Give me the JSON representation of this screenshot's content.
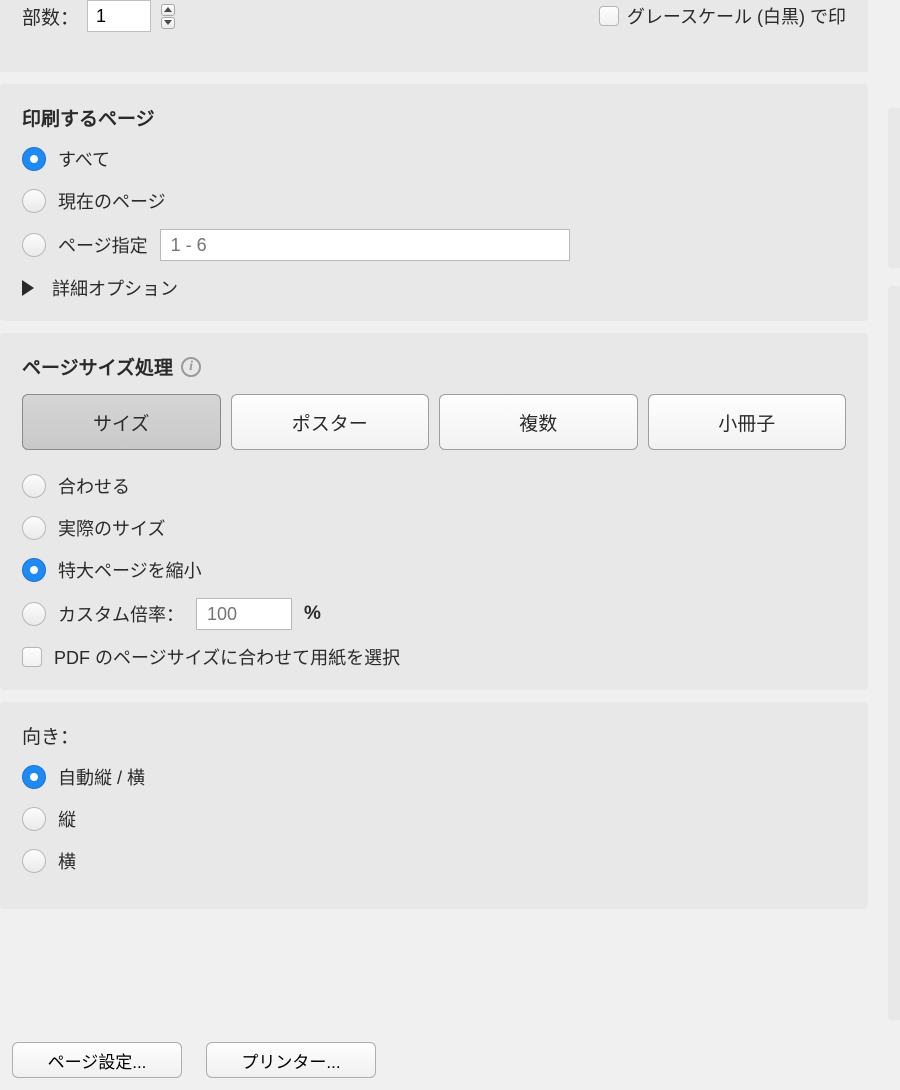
{
  "top": {
    "copies_label": "部数：",
    "copies_value": "1",
    "grayscale_label": "グレースケール (白黒) で印"
  },
  "pages": {
    "title": "印刷するページ",
    "options": {
      "all": "すべて",
      "current": "現在のページ",
      "range": "ページ指定"
    },
    "range_placeholder": "1 - 6",
    "advanced": "詳細オプション"
  },
  "sizing": {
    "title": "ページサイズ処理",
    "tabs": {
      "size": "サイズ",
      "poster": "ポスター",
      "multiple": "複数",
      "booklet": "小冊子"
    },
    "options": {
      "fit": "合わせる",
      "actual": "実際のサイズ",
      "shrink": "特大ページを縮小",
      "custom": "カスタム倍率："
    },
    "custom_value": "100",
    "custom_unit": "%",
    "choose_paper": "PDF のページサイズに合わせて用紙を選択"
  },
  "orientation": {
    "title": "向き：",
    "options": {
      "auto": "自動縦 / 横",
      "portrait": "縦",
      "landscape": "横"
    }
  },
  "footer": {
    "page_setup": "ページ設定...",
    "printer": "プリンター..."
  }
}
